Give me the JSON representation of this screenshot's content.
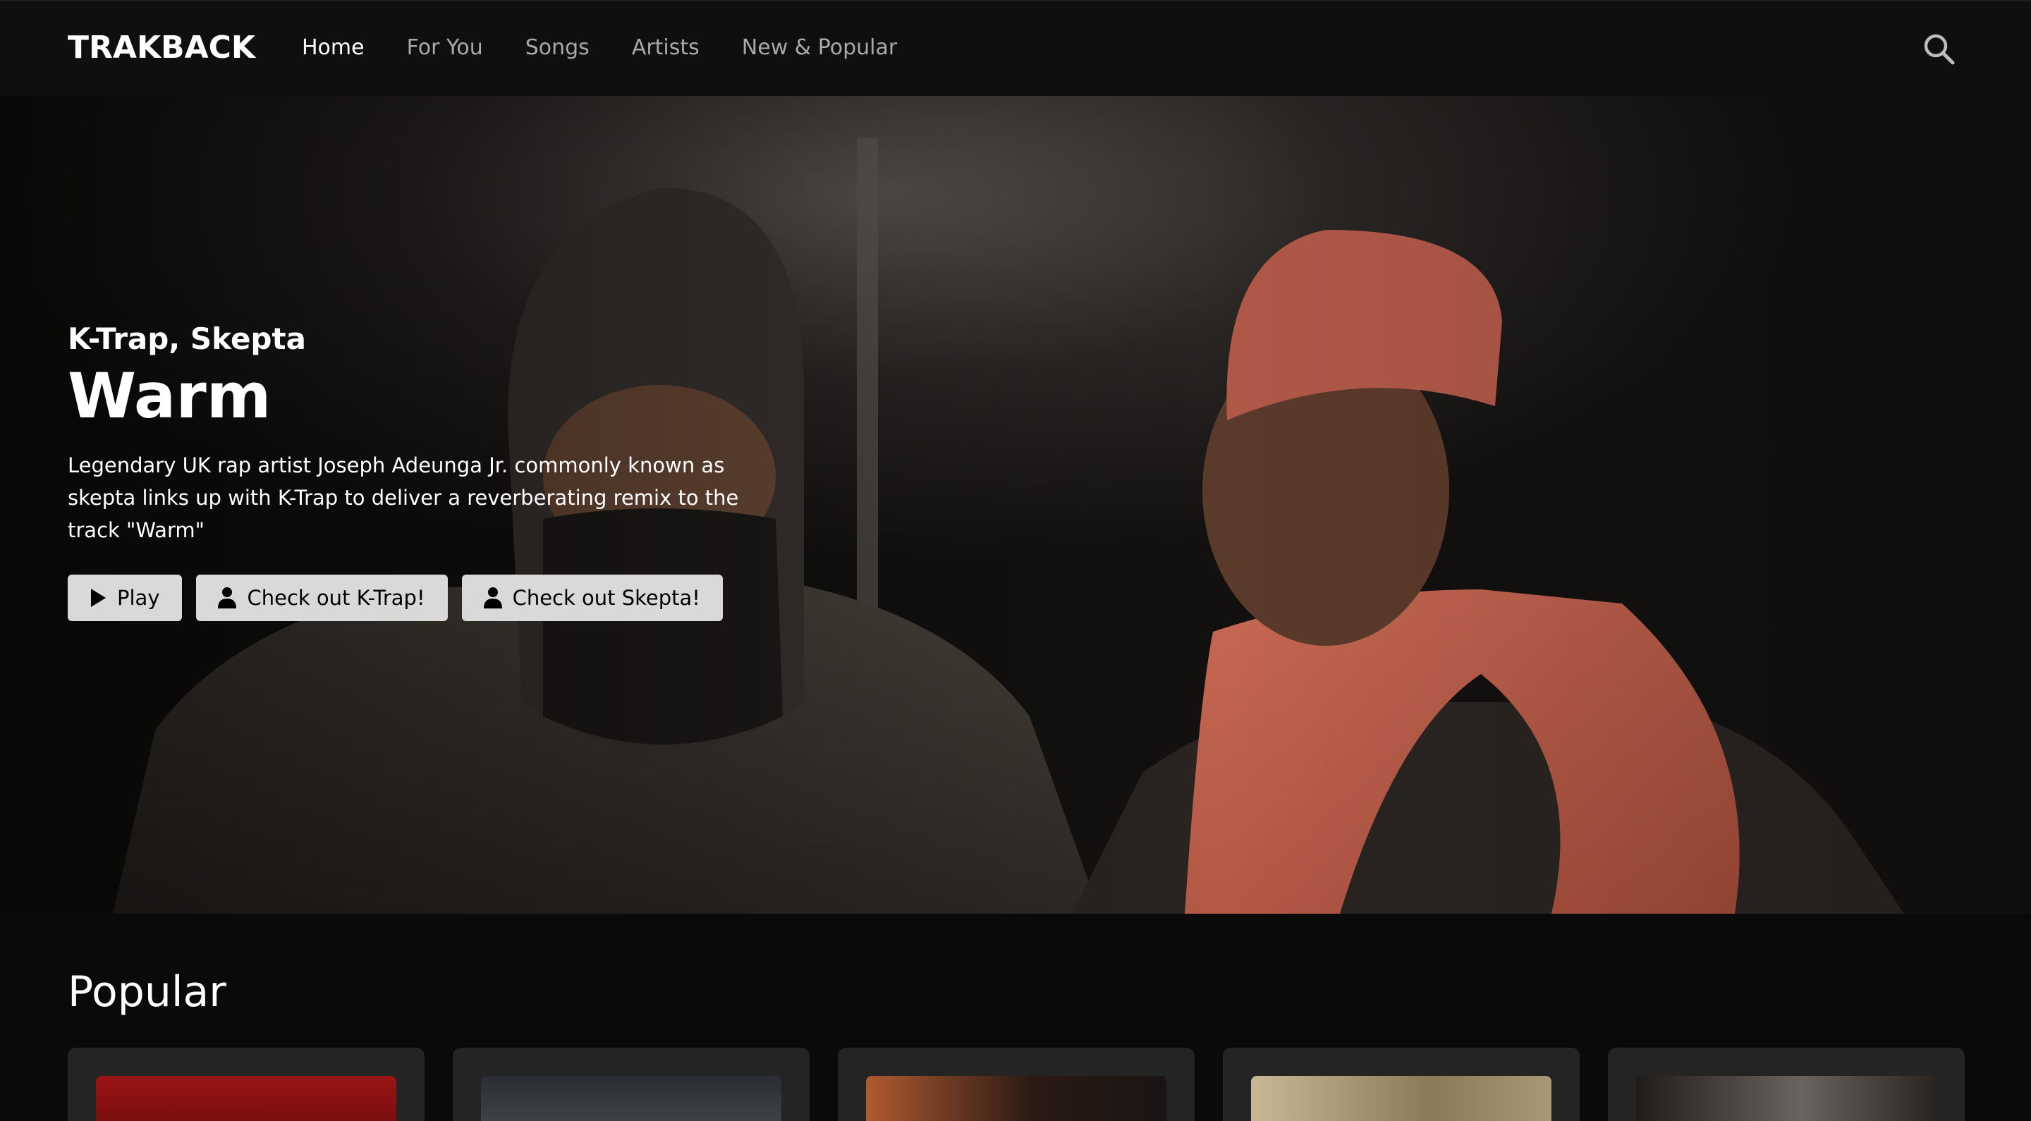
{
  "brand": {
    "logo": "TRAKBACK"
  },
  "nav": {
    "items": [
      {
        "label": "Home",
        "active": true
      },
      {
        "label": "For You",
        "active": false
      },
      {
        "label": "Songs",
        "active": false
      },
      {
        "label": "Artists",
        "active": false
      },
      {
        "label": "New & Popular",
        "active": false
      }
    ],
    "search_icon": "search-icon"
  },
  "hero": {
    "artists": "K-Trap, Skepta",
    "title": "Warm",
    "description": "Legendary UK rap artist Joseph Adeunga Jr. commonly known as skepta links up with K-Trap to deliver a reverberating remix to the track \"Warm\"",
    "buttons": {
      "play": "Play",
      "artist_one": "Check out K-Trap!",
      "artist_two": "Check out Skepta!"
    }
  },
  "popular": {
    "heading": "Popular",
    "cards": [
      {
        "thumb_color": "#8a1010"
      },
      {
        "thumb_color": "#3a3d42"
      },
      {
        "thumb_color": "#a0502a"
      },
      {
        "thumb_color": "#b8a888"
      },
      {
        "thumb_color": "#2a2420"
      }
    ]
  },
  "colors": {
    "background": "#0a0a0a",
    "nav_background": "#0f0f0f",
    "button_background": "#d9d9d9",
    "card_background": "#242424",
    "nav_inactive": "#a9a9a9"
  }
}
